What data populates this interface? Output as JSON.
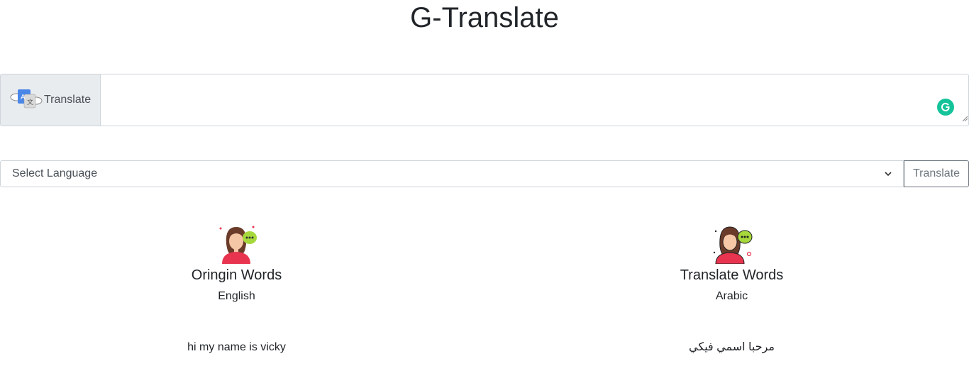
{
  "app": {
    "title": "G-Translate"
  },
  "input": {
    "addon_label": "Translate",
    "value": "",
    "placeholder": ""
  },
  "controls": {
    "select_label": "Select Language",
    "button_label": "Translate"
  },
  "origin": {
    "heading": "Oringin Words",
    "language": "English",
    "text": "hi my name is vicky"
  },
  "result": {
    "heading": "Translate Words",
    "language": "Arabic",
    "text": "مرحبا اسمي فيكي"
  },
  "icons": {
    "addon": "translate-icon",
    "grammarly": "grammarly-icon",
    "origin_avatar": "woman-speaking-icon",
    "result_avatar": "woman-chat-icon",
    "select_arrow": "chevron-down-icon"
  },
  "colors": {
    "grammarly": "#15c39a",
    "addon_bg": "#e9ecef",
    "avatar_shirt": "#e8344e",
    "chat_bubble": "#a6d83c"
  }
}
